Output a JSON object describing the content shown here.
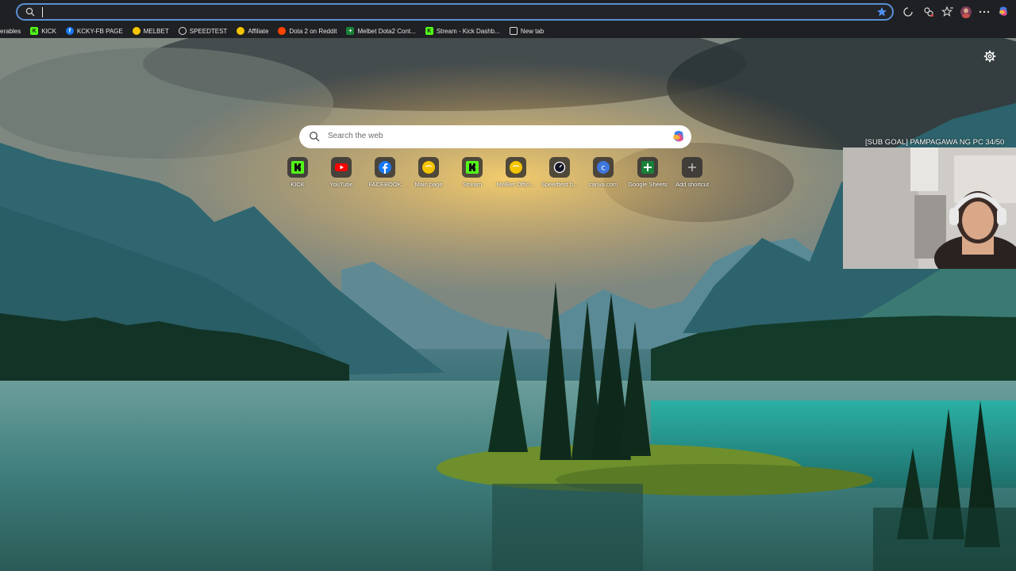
{
  "browser": {
    "address_value": "",
    "toolbar_icons": [
      "extensions-icon",
      "cast-icon",
      "favorites-icon",
      "profile-avatar",
      "more-menu-icon",
      "copilot-icon"
    ]
  },
  "bookmarks": [
    {
      "label": "erables",
      "icon": "favorites-folder-icon",
      "color": "#1f2023"
    },
    {
      "label": "KICK",
      "icon": "kick-icon",
      "color": "#53fc18"
    },
    {
      "label": "KCKY-FB PAGE",
      "icon": "facebook-icon",
      "color": "#1877f2"
    },
    {
      "label": "MELBET",
      "icon": "melbet-icon",
      "color": "#f5c400"
    },
    {
      "label": "SPEEDTEST",
      "icon": "speedtest-icon",
      "color": "#1f2023"
    },
    {
      "label": "Affiliate",
      "icon": "melbet-icon",
      "color": "#f5c400"
    },
    {
      "label": "Dota 2 on Reddit",
      "icon": "reddit-icon",
      "color": "#ff4500"
    },
    {
      "label": "Melbet Dota2 Cont...",
      "icon": "sheets-icon",
      "color": "#188038"
    },
    {
      "label": "Stream - Kick Dashb...",
      "icon": "kick-icon",
      "color": "#53fc18"
    },
    {
      "label": "New tab",
      "icon": "page-icon",
      "color": "#1f2023"
    }
  ],
  "search": {
    "placeholder": "Search the web"
  },
  "shortcuts": [
    {
      "label": "KICK",
      "icon": "kick-icon"
    },
    {
      "label": "YouTube",
      "icon": "youtube-icon"
    },
    {
      "label": "FACEBOOK",
      "icon": "facebook-icon"
    },
    {
      "label": "Main page",
      "icon": "melbet-icon"
    },
    {
      "label": "Stream",
      "icon": "kick-icon"
    },
    {
      "label": "MelBet Offici...",
      "icon": "melbet-icon"
    },
    {
      "label": "Speedtest b...",
      "icon": "speedtest-icon"
    },
    {
      "label": "canva.com",
      "icon": "canva-icon"
    },
    {
      "label": "Google Sheets",
      "icon": "sheets-icon"
    },
    {
      "label": "Add shortcut",
      "icon": "plus-icon"
    }
  ],
  "overlay": {
    "goal_text": "[SUB GOAL] PAMPAGAWA NG PC 34/50"
  },
  "colors": {
    "accent": "#5a8fd6",
    "kick": "#53fc18",
    "youtube": "#ff0000",
    "facebook": "#1877f2",
    "melbet": "#f5c400",
    "sheets": "#188038"
  }
}
